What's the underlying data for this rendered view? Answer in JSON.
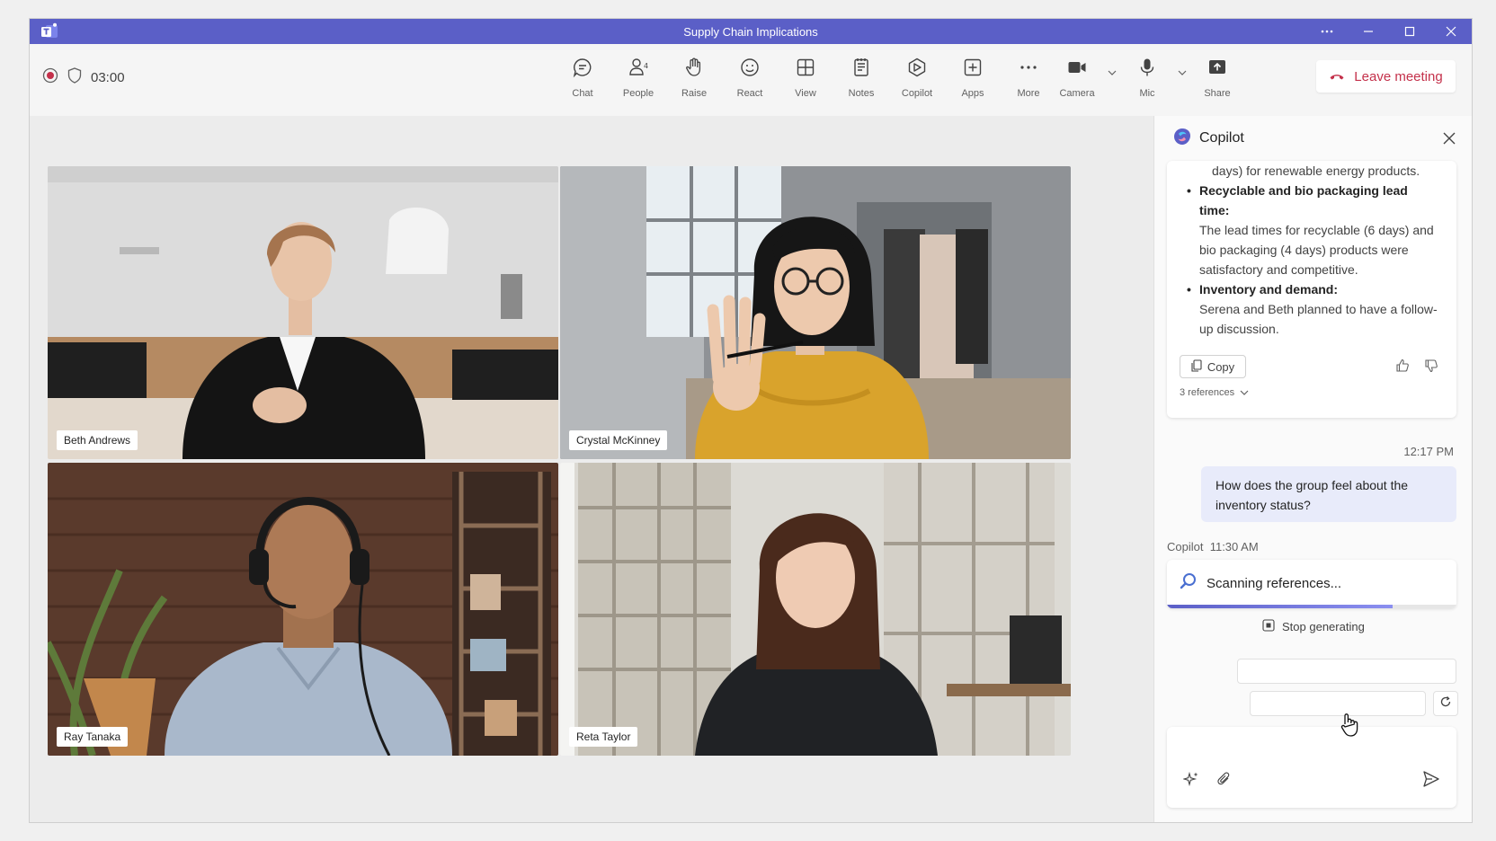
{
  "window": {
    "title": "Supply Chain Implications"
  },
  "toolbar": {
    "timer": "03:00",
    "items": [
      {
        "label": "Chat",
        "icon": "chat-icon"
      },
      {
        "label": "People",
        "icon": "people-icon"
      },
      {
        "label": "Raise",
        "icon": "raise-hand-icon"
      },
      {
        "label": "React",
        "icon": "react-icon"
      },
      {
        "label": "View",
        "icon": "view-icon"
      },
      {
        "label": "Notes",
        "icon": "notes-icon"
      },
      {
        "label": "Copilot",
        "icon": "copilot-icon"
      },
      {
        "label": "Apps",
        "icon": "apps-icon"
      },
      {
        "label": "More",
        "icon": "more-icon"
      }
    ],
    "devices": [
      {
        "label": "Camera",
        "icon": "camera-icon"
      },
      {
        "label": "Mic",
        "icon": "mic-icon"
      },
      {
        "label": "Share",
        "icon": "share-icon"
      }
    ],
    "leave_label": "Leave meeting"
  },
  "participants": [
    {
      "name": "Beth Andrews"
    },
    {
      "name": "Crystal McKinney"
    },
    {
      "name": "Ray Tanaka"
    },
    {
      "name": "Reta Taylor"
    }
  ],
  "copilot": {
    "title": "Copilot",
    "response": {
      "line1": "days) for renewable energy products.",
      "bullet1_title": "Recyclable and bio packaging lead time:",
      "bullet1_body": "The lead times for recyclable (6 days) and bio packaging (4 days) products were satisfactory and competitive.",
      "bullet2_title": "Inventory and demand:",
      "bullet2_body": "Serena and Beth planned to have a follow-up discussion.",
      "copy_label": "Copy",
      "references": "3 references"
    },
    "user_time": "12:17 PM",
    "user_message": "How does the group feel about the inventory status?",
    "bot_name": "Copilot",
    "bot_time": "11:30 AM",
    "scanning": "Scanning references...",
    "scan_progress": 0.78,
    "stop_label": "Stop generating"
  },
  "colors": {
    "brand": "#5b5fc7",
    "leave": "#c4314b",
    "bubble": "#e8ebfa"
  }
}
